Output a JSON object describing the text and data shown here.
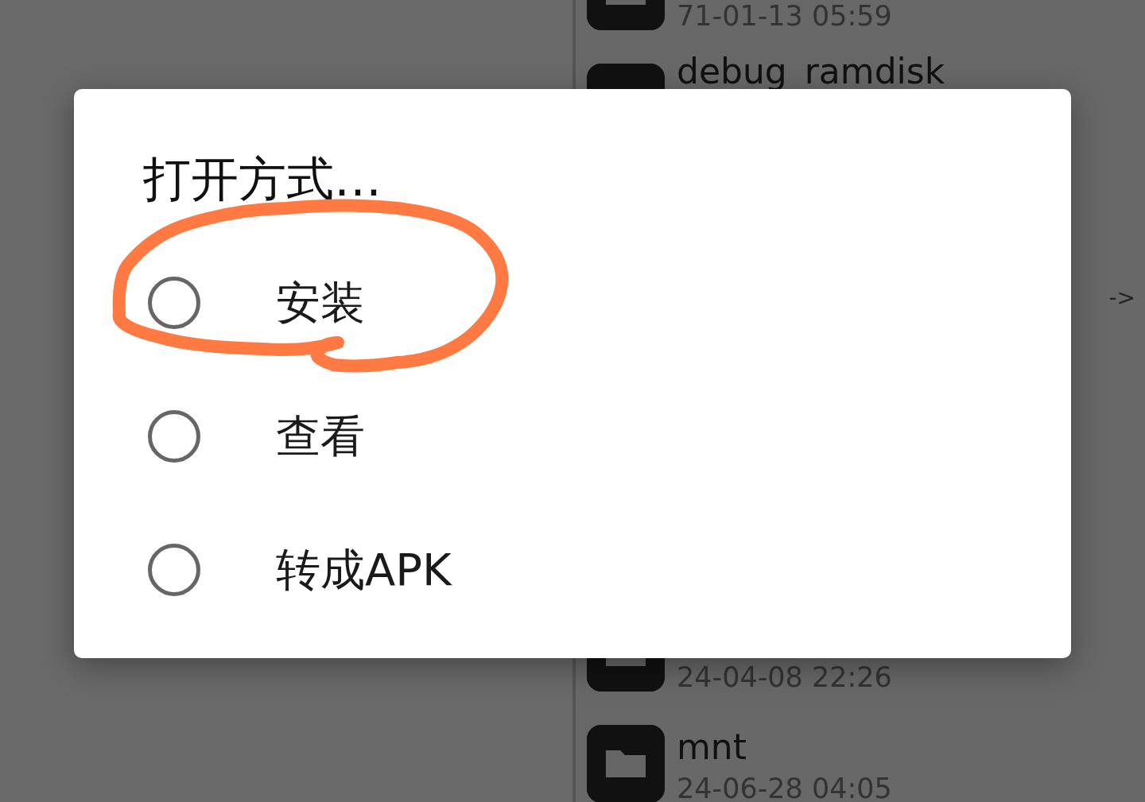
{
  "file_list": {
    "items": [
      {
        "date": "71-01-13 05:59"
      },
      {
        "name": "debug_ramdisk"
      },
      {
        "date": "24-04-08 22:26"
      },
      {
        "name": "mnt",
        "date": "24-06-28 04:05"
      }
    ],
    "link_arrow": "->"
  },
  "dialog": {
    "title": "打开方式…",
    "options": [
      {
        "label": "安装",
        "selected": false,
        "circled": true
      },
      {
        "label": "查看",
        "selected": false,
        "circled": false
      },
      {
        "label": "转成APK",
        "selected": false,
        "circled": false
      }
    ]
  }
}
